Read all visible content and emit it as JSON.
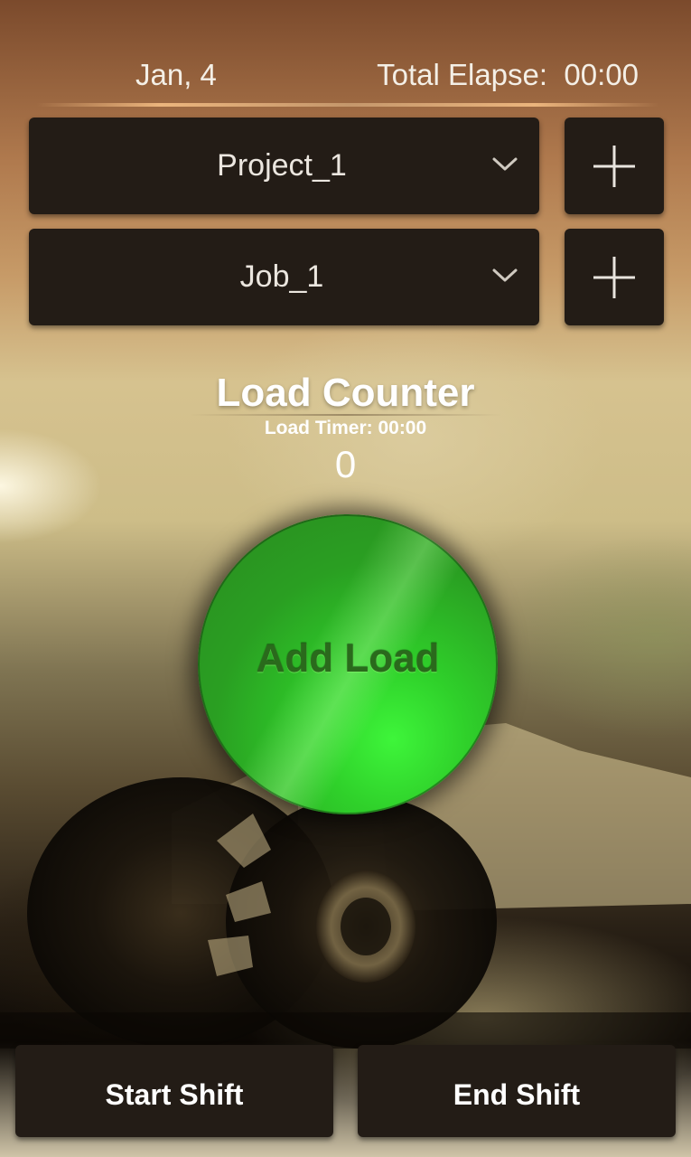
{
  "header": {
    "date": "Jan, 4",
    "elapse_label": "Total Elapse:",
    "elapse_value": "00:00"
  },
  "project": {
    "selected": "Project_1"
  },
  "job": {
    "selected": "Job_1"
  },
  "counter": {
    "title": "Load Counter",
    "timer_label": "Load Timer: 00:00",
    "count": "0",
    "add_button_label": "Add Load"
  },
  "footer": {
    "start_label": "Start Shift",
    "end_label": "End Shift"
  },
  "colors": {
    "panel": "#231c16",
    "add_load_green": "#3ef53a"
  },
  "icons": {
    "dropdown": "chevron-down-icon",
    "add": "plus-icon"
  }
}
